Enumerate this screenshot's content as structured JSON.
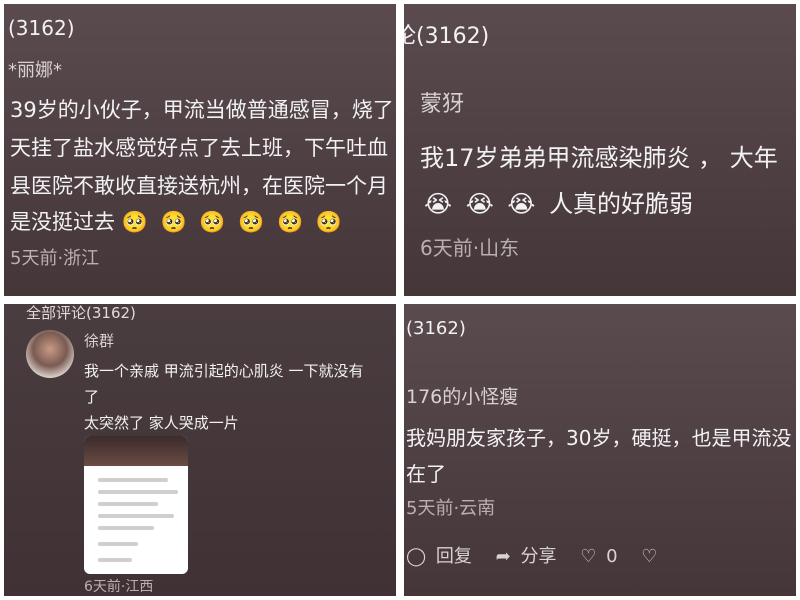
{
  "panels": [
    {
      "comment_count": "(3162)",
      "user": "*丽娜*",
      "lines": [
        "39岁的小伙子，甲流当做普通感冒，烧了",
        "天挂了盐水感觉好点了去上班，下午吐血",
        "县医院不敢收直接送杭州，在医院一个月",
        "是没挺过去"
      ],
      "emojis": [
        "🥺",
        "🥺",
        "🥺",
        "🥺",
        "🥺",
        "🥺"
      ],
      "meta": "5天前·浙江"
    },
    {
      "comment_count": "论(3162)",
      "user": "蒙犽",
      "line1": "我17岁弟弟甲流感染肺炎 ， 大年",
      "emojis": [
        "😭",
        "😭",
        "😭"
      ],
      "line2_text": "人真的好脆弱",
      "meta": "6天前·山东"
    },
    {
      "header": "全部评论(3162)",
      "user": "徐群",
      "lines": [
        "我一个亲戚  甲流引起的心肌炎   一下就没有",
        "了",
        "太突然了  家人哭成一片"
      ],
      "meta": "6天前·江西"
    },
    {
      "comment_count": "(3162)",
      "user": "176的小怪瘦",
      "lines": [
        "我妈朋友家孩子，30岁，硬挺，也是甲流没",
        "在了"
      ],
      "meta": "5天前·云南",
      "actions": {
        "reply": "回复",
        "share": "分享",
        "likes": "0"
      }
    }
  ]
}
